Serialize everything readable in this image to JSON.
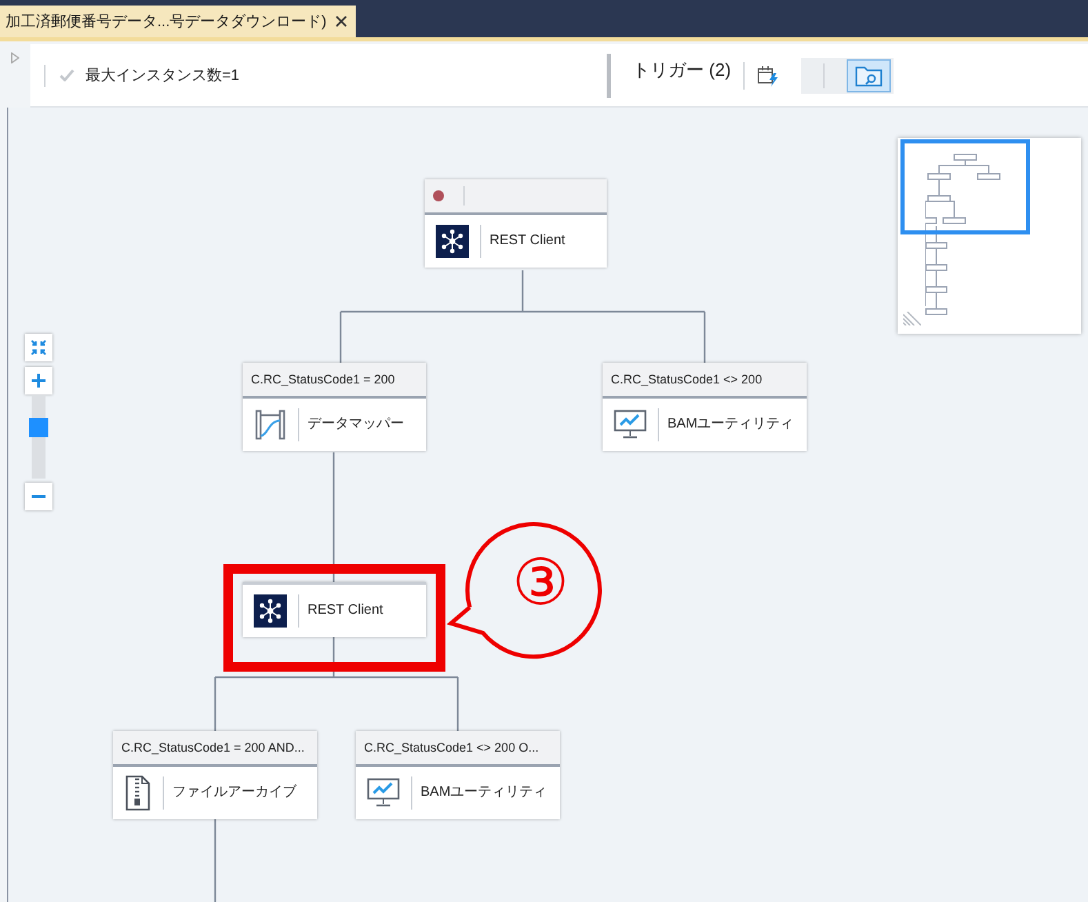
{
  "tab": {
    "title": "加工済郵便番号データ...号データダウンロード)"
  },
  "toolbar": {
    "max_instances": "最大インスタンス数=1",
    "triggers": "トリガー (2)",
    "overview_toggle": {
      "selected": true
    }
  },
  "zoom": {
    "level": 0.66
  },
  "nodes": [
    {
      "status_dot": true,
      "label": "REST Client",
      "kind": "rest",
      "highlighted": false
    },
    {
      "condition": "C.RC_StatusCode1 = 200",
      "label": "データマッパー",
      "kind": "mapper",
      "highlighted": false
    },
    {
      "condition": "C.RC_StatusCode1 <> 200",
      "label": "BAMユーティリティ",
      "kind": "bam",
      "highlighted": false
    },
    {
      "label": "REST Client",
      "kind": "rest",
      "highlighted": true
    },
    {
      "condition": "C.RC_StatusCode1 = 200 AND...",
      "label": "ファイルアーカイブ",
      "kind": "archive",
      "highlighted": false
    },
    {
      "condition": "C.RC_StatusCode1 <> 200 O...",
      "label": "BAMユーティリティ",
      "kind": "bam",
      "highlighted": false
    }
  ],
  "annotation": {
    "label": "③"
  }
}
